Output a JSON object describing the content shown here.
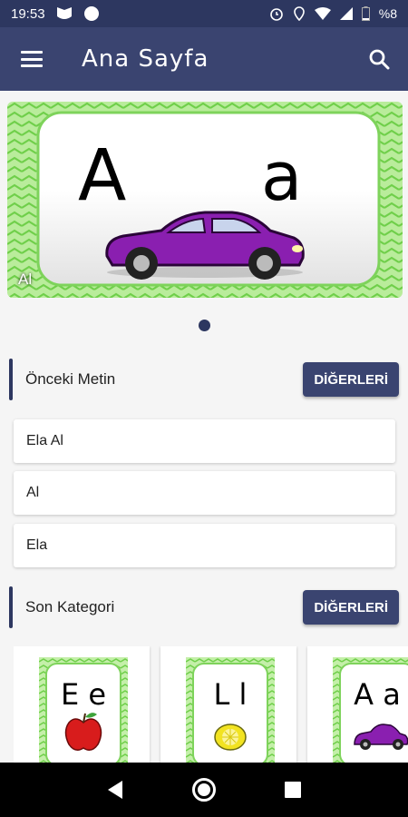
{
  "status": {
    "time": "19:53",
    "battery": "%8"
  },
  "appbar": {
    "title": "Ana Sayfa"
  },
  "banner": {
    "caption": "Al",
    "upper": "A",
    "lower": "a"
  },
  "previous_text": {
    "title": "Önceki Metin",
    "more_label": "DİĞERLERİ",
    "items": [
      "Ela Al",
      "Al",
      "Ela"
    ]
  },
  "last_category": {
    "title": "Son Kategori",
    "more_label": "DİĞERLERİ",
    "cards": [
      {
        "letters": "E e",
        "picture": "apple-icon"
      },
      {
        "letters": "L l",
        "picture": "lemon-icon"
      },
      {
        "letters": "A a",
        "picture": "car-icon"
      }
    ]
  },
  "colors": {
    "primary": "#3a4470",
    "statusbar": "#2d3760",
    "pattern_green": "#7ed35b"
  }
}
